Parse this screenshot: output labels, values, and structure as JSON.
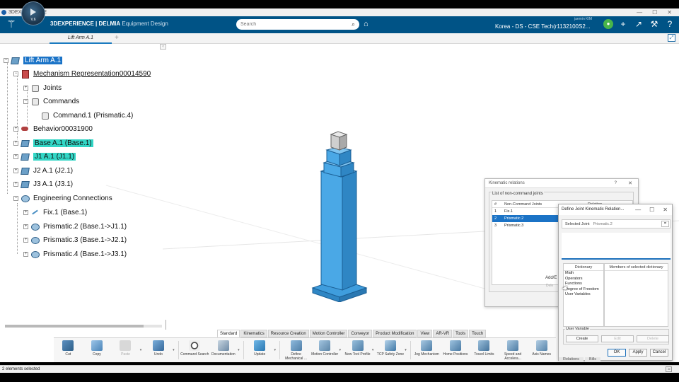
{
  "window": {
    "title": "3DEXPERIENCE"
  },
  "header": {
    "brand_bold": "3DEXPERIENCE | DELMIA",
    "app_name": "Equipment Design",
    "compass_version": "V.6",
    "search_placeholder": "Search",
    "tenant_label": "Korea - DS - CSE Tech(r1132100S2...",
    "tenant_user": "jaemin KIM"
  },
  "tabs": {
    "active": "Lift Arm A.1"
  },
  "tree": {
    "nodes": [
      {
        "label": "Lift Arm A.1"
      },
      {
        "label": "Mechanism Representation00014590"
      },
      {
        "label": "Joints"
      },
      {
        "label": "Commands"
      },
      {
        "label": "Command.1 (Prismatic.4)"
      },
      {
        "label": "Behavior00031900"
      },
      {
        "label": "Base A.1 (Base.1)"
      },
      {
        "label": "J1 A.1 (J1.1)"
      },
      {
        "label": "J2 A.1 (J2.1)"
      },
      {
        "label": "J3 A.1 (J3.1)"
      },
      {
        "label": "Engineering Connections"
      },
      {
        "label": "Fix.1 (Base.1)"
      },
      {
        "label": "Prismatic.2 (Base.1->J1.1)"
      },
      {
        "label": "Prismatic.3 (Base.1->J2.1)"
      },
      {
        "label": "Prismatic.4 (Base.1->J3.1)"
      }
    ]
  },
  "kinematic_dialog": {
    "title": "Kinematic relations",
    "help": "?",
    "close": "✕",
    "group_label": "List of non-command joints",
    "columns": [
      "#",
      "Non-Command Joints",
      "Relation"
    ],
    "rows": [
      {
        "n": "1",
        "joint": "Fix.1",
        "relation": ""
      },
      {
        "n": "2",
        "joint": "Prismatic.2",
        "relation": ""
      },
      {
        "n": "3",
        "joint": "Prismatic.3",
        "relation": ""
      }
    ],
    "add_button": "Add/E",
    "second_button": "Dele"
  },
  "relation_dialog": {
    "title": "Define Joint Kinematic Relation...",
    "selected_joint_label": "Selected Joint",
    "selected_joint_value": "Prismatic.2",
    "eq_button": "=",
    "dictionary_header": "Dictionary",
    "members_header": "Members of selected dictionary",
    "dictionary_items": [
      "Math",
      "Operators",
      "Functions",
      "Degree of Freedom",
      "User Variables"
    ],
    "user_variable_label": "User Variable",
    "create_button": "Create",
    "edit_button": "Edit",
    "delete_button": "Delete",
    "ok_button": "OK",
    "apply_button": "Apply",
    "cancel_button": "Cancel",
    "min_glyph": "—",
    "max_glyph": "☐",
    "close_glyph": "✕"
  },
  "action_tabs": [
    "Standard",
    "Kinematics",
    "Resource Creation",
    "Motion Controller",
    "Conveyor",
    "Product Modification",
    "View",
    "AR-VR",
    "Tools",
    "Touch"
  ],
  "action_commands": [
    {
      "label": "Cut",
      "icon": "scissors-icon"
    },
    {
      "label": "Copy",
      "icon": "copy-icon"
    },
    {
      "label": "Paste",
      "icon": "paste-icon"
    },
    {
      "label": "Undo",
      "icon": "undo-icon"
    },
    {
      "label": "Command Search",
      "icon": "command-search-icon"
    },
    {
      "label": "Documentation",
      "icon": "documentation-icon"
    },
    {
      "label": "Update",
      "icon": "update-icon"
    },
    {
      "label": "Define Mechanical ...",
      "icon": "define-mechanical-icon"
    },
    {
      "label": "Motion Controller",
      "icon": "motion-controller-icon"
    },
    {
      "label": "New Tool Profile",
      "icon": "tool-profile-icon"
    },
    {
      "label": "TCP Safety Zone",
      "icon": "tcp-zone-icon"
    },
    {
      "label": "Jog Mechanism",
      "icon": "jog-icon"
    },
    {
      "label": "Home Positions",
      "icon": "home-positions-icon"
    },
    {
      "label": "Travel Limits",
      "icon": "travel-limits-icon"
    },
    {
      "label": "Speed and Accelera...",
      "icon": "speed-icon"
    },
    {
      "label": "Axis Names",
      "icon": "axis-names-icon"
    }
  ],
  "bottom_right_tabs": [
    "Relations",
    "Bills"
  ],
  "status": {
    "text": "2 elements selected"
  },
  "colors": {
    "topbar": "#005386",
    "selection": "#1a73c7",
    "highlight": "#33d6c6",
    "part_fill": "#3f9ddd"
  }
}
